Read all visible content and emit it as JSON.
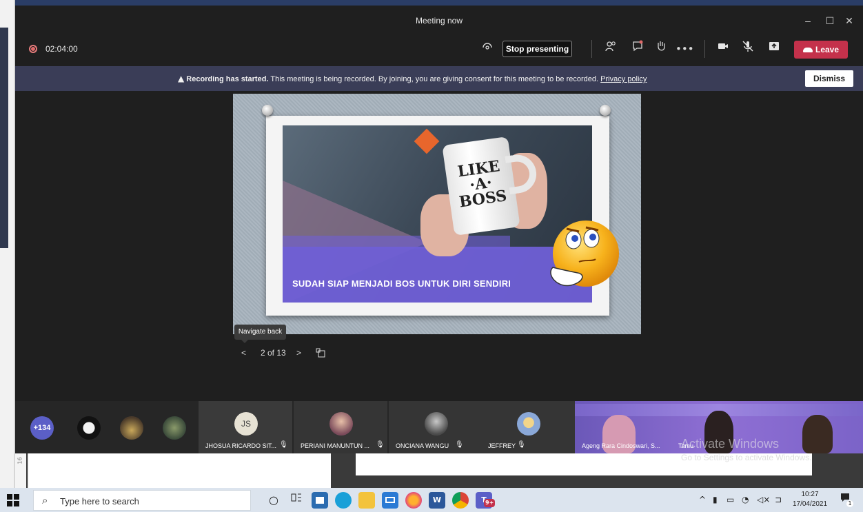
{
  "window": {
    "title": "Meeting now",
    "controls": {
      "minimize": "–",
      "maximize": "☐",
      "close": "✕"
    }
  },
  "toolbar": {
    "timer": "02:04:00",
    "stop_presenting": "Stop presenting",
    "more": "•••",
    "leave": "Leave"
  },
  "banner": {
    "title": "Recording has started.",
    "message": "This meeting is being recorded. By joining, you are giving consent for this meeting to be recorded.",
    "link": "Privacy policy",
    "dismiss": "Dismiss"
  },
  "slide": {
    "mug_text": "LIKE\n·A·\nBOSS",
    "caption": "SUDAH SIAP MENJADI BOS UNTUK DIRI SENDIRI",
    "tooltip": "Navigate back",
    "page_indicator": "2 of 13"
  },
  "participants": {
    "more_count": "+134",
    "tiles": [
      {
        "initials": "JS",
        "name": "JHOSUA RICARDO SIT..."
      },
      {
        "initials": "",
        "name": "PERIANI MANUNTUN ..."
      },
      {
        "initials": "",
        "name": "ONCIANA WANGU"
      },
      {
        "initials": "",
        "name": "JEFFREY"
      }
    ],
    "video_labels": [
      "Ageng Rara Cindoswari, S...",
      "Tamu"
    ]
  },
  "watermark": {
    "line1": "Activate Windows",
    "line2": "Go to Settings to activate Windows."
  },
  "doc": {
    "ruler": "16"
  },
  "taskbar": {
    "search_placeholder": "Type here to search",
    "teams_badge": "9+",
    "time": "10:27",
    "date": "17/04/2021",
    "notification_count": "1"
  },
  "colors": {
    "leave": "#c4314b",
    "banner": "#3a3d57",
    "accent": "#5b5fc7",
    "slide_purple": "#6f5fd6",
    "diamond": "#e8662c"
  }
}
